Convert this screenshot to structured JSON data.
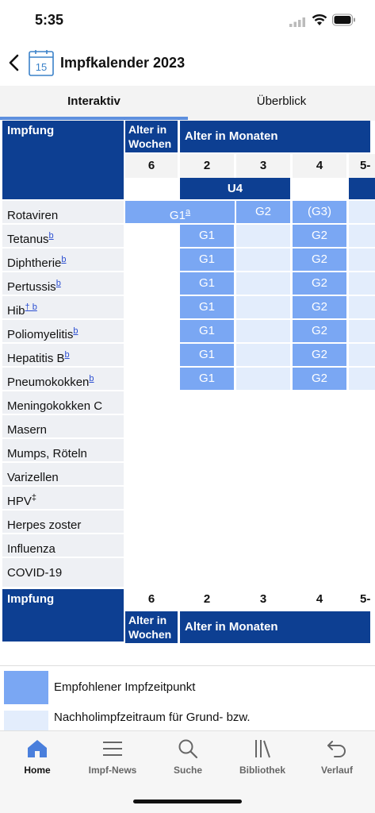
{
  "status": {
    "time": "5:35"
  },
  "header": {
    "title": "Impfkalender 2023",
    "calendar_day": "15"
  },
  "tabs": [
    {
      "label": "Interaktiv"
    },
    {
      "label": "Überblick"
    }
  ],
  "table": {
    "corner_label": "Impfung",
    "weeks_header": "Alter in Wochen",
    "months_header": "Alter in Monaten",
    "ages": [
      "6",
      "2",
      "3",
      "4",
      "5-"
    ],
    "u_label": "U4",
    "rows": [
      {
        "name": "Rotaviren",
        "sup": ""
      },
      {
        "name": "Tetanus",
        "sup": "b"
      },
      {
        "name": "Diphtherie",
        "sup": "b"
      },
      {
        "name": "Pertussis",
        "sup": "b"
      },
      {
        "name": "Hib",
        "sup": "† b"
      },
      {
        "name": "Poliomyelitis",
        "sup": "b"
      },
      {
        "name": "Hepatitis B",
        "sup": "b"
      },
      {
        "name": "Pneumokokken",
        "sup": "b"
      },
      {
        "name": "Meningokokken C",
        "sup": ""
      },
      {
        "name": "Masern",
        "sup": ""
      },
      {
        "name": "Mumps, Röteln",
        "sup": ""
      },
      {
        "name": "Varizellen",
        "sup": ""
      },
      {
        "name": "HPV",
        "sup": "‡"
      },
      {
        "name": "Herpes zoster",
        "sup": ""
      },
      {
        "name": "Influenza",
        "sup": ""
      },
      {
        "name": "COVID-19",
        "sup": ""
      }
    ],
    "rota": {
      "g1": "G1",
      "g1_sup": "a",
      "g2": "G2",
      "g3": "(G3)"
    },
    "dose_g1": "G1",
    "dose_g2": "G2"
  },
  "legend": [
    {
      "label": "Empfohlener Impfzeitpunkt",
      "color": "#7aa7f3"
    },
    {
      "label": "Nachholimpfzeitraum für Grund- bzw.",
      "color": "#e3edfc"
    }
  ],
  "bottom_nav": [
    {
      "label": "Home",
      "icon": "home-icon"
    },
    {
      "label": "Impf-News",
      "icon": "menu-icon"
    },
    {
      "label": "Suche",
      "icon": "search-icon"
    },
    {
      "label": "Bibliothek",
      "icon": "library-icon"
    },
    {
      "label": "Verlauf",
      "icon": "undo-icon"
    }
  ],
  "colors": {
    "header_blue": "#0d3f92",
    "recommended": "#7aa7f3",
    "catchup": "#e3edfc",
    "tab_indicator": "#5d8fde"
  }
}
